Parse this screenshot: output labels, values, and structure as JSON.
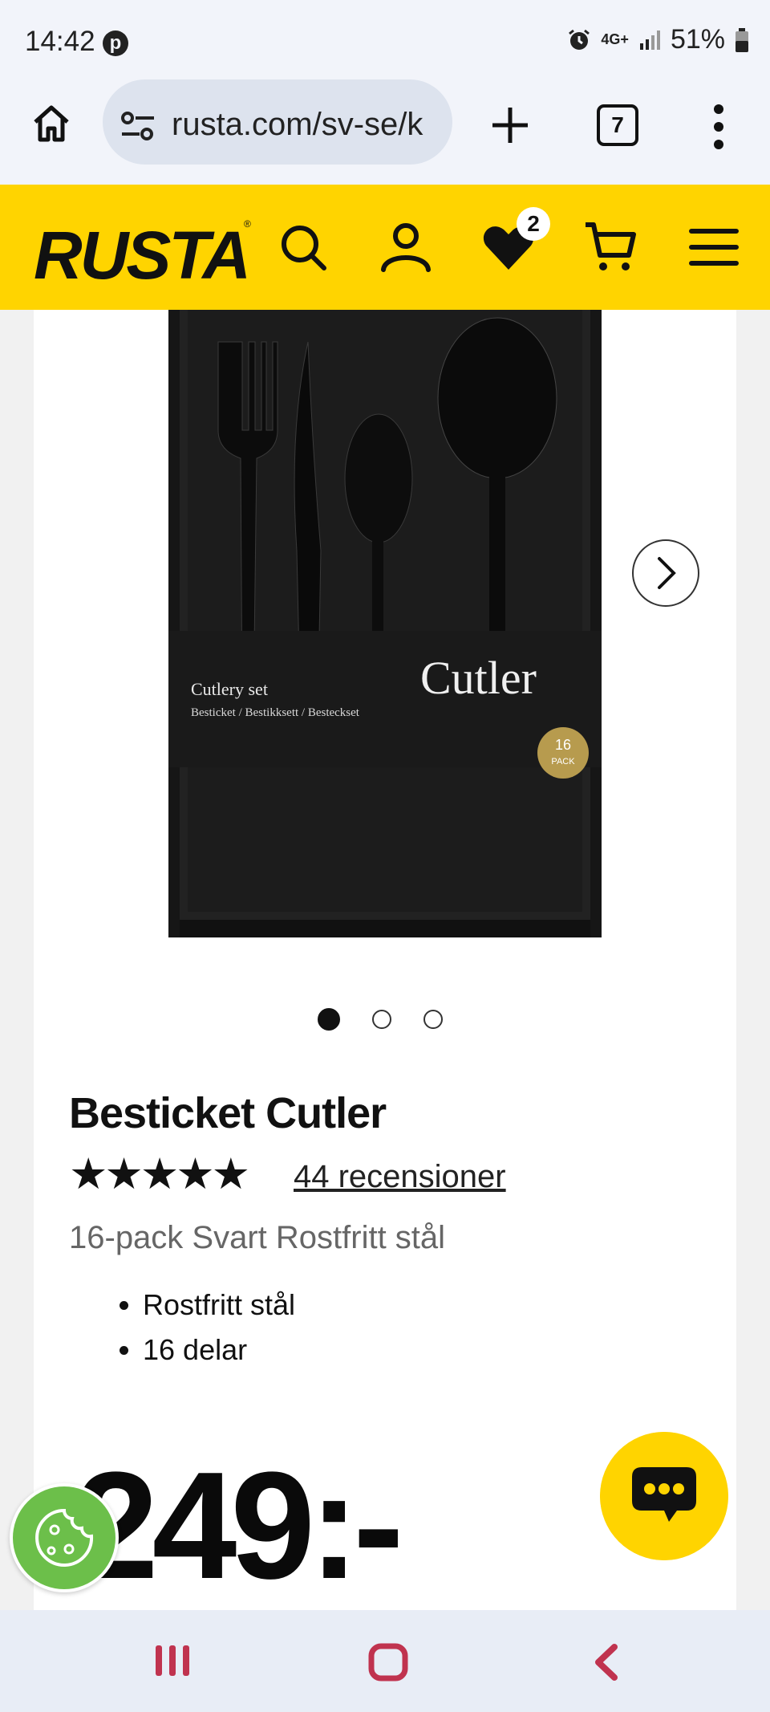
{
  "status_bar": {
    "time": "14:42",
    "network": "4G+",
    "battery": "51%",
    "icons": [
      "pinterest-icon",
      "alarm-icon",
      "signal-icon",
      "battery-icon"
    ]
  },
  "browser": {
    "url": "rusta.com/sv-se/k",
    "tab_count": "7",
    "icons": [
      "home-icon",
      "site-settings-icon",
      "new-tab-icon",
      "tabs-icon",
      "more-vert-icon"
    ]
  },
  "site_header": {
    "logo": "RUSTA",
    "logo_mark": "®",
    "wishlist_count": "2",
    "accent_color": "#ffd400",
    "icons": [
      "search-icon",
      "account-icon",
      "heart-icon",
      "cart-icon",
      "hamburger-menu-icon"
    ]
  },
  "product": {
    "title": "Besticket Cutler",
    "image": {
      "label_main": "Cutlery set",
      "label_sub": "Besticket / Bestikksett / Besteckset",
      "brand": "Cutler",
      "pack_count": "16",
      "pack_word": "PACK"
    },
    "rating": "★★★★★",
    "rating_value": 5,
    "reviews": "44 recensioner",
    "subtitle": "16-pack Svart Rostfritt stål",
    "features": [
      "Rostfritt stål",
      "16 delar"
    ],
    "price": "249:-",
    "carousel": {
      "total": 3,
      "active": 1
    }
  },
  "floating": {
    "icons": [
      "chat-icon",
      "cookie-icon"
    ]
  },
  "nav_bar": {
    "icons": [
      "recents-icon",
      "home-nav-icon",
      "back-icon"
    ]
  }
}
